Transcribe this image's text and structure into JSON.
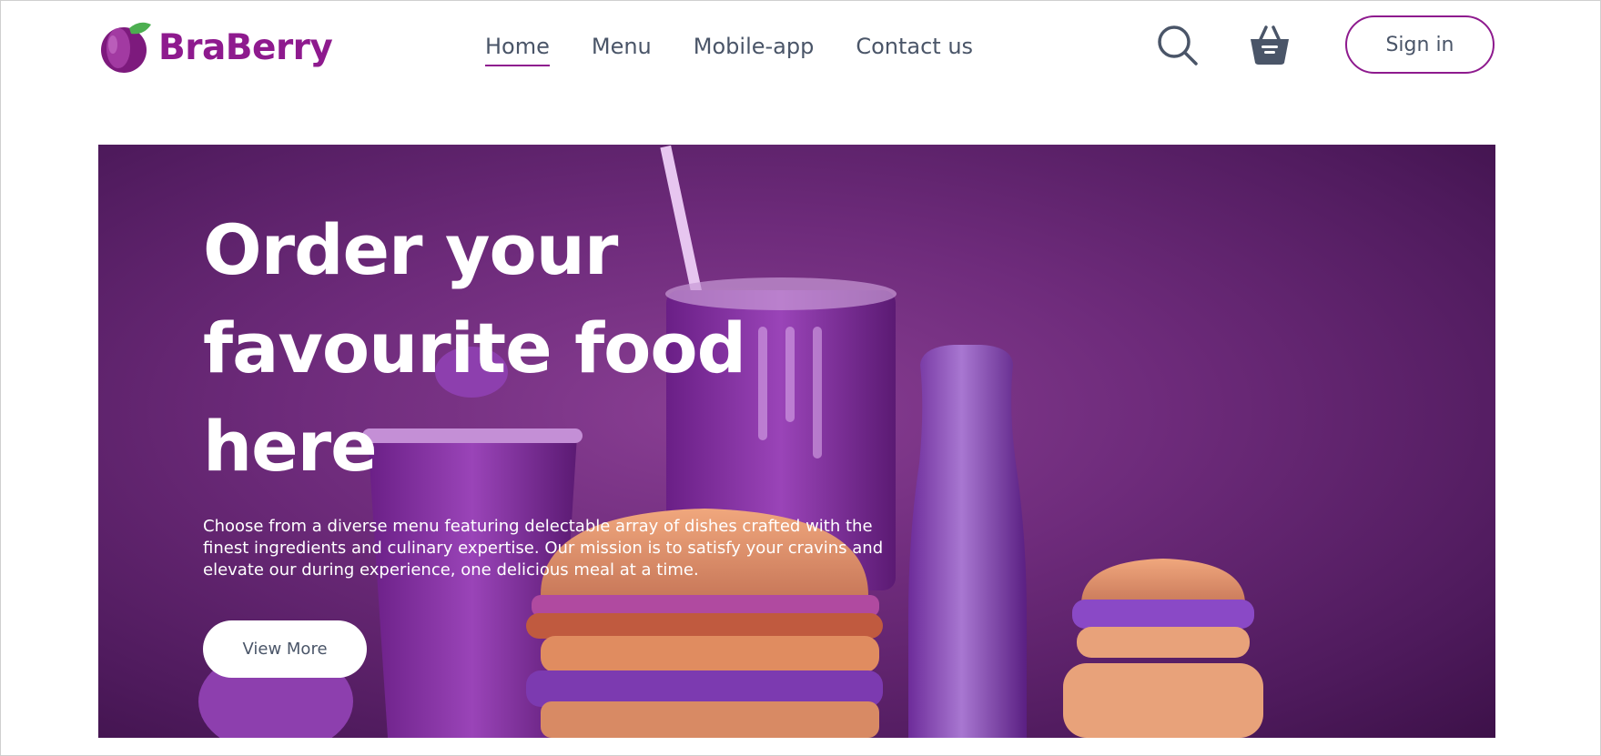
{
  "brand": {
    "name": "BraBerry",
    "color": "#8e1a8e"
  },
  "nav": {
    "items": [
      {
        "label": "Home",
        "active": true
      },
      {
        "label": "Menu",
        "active": false
      },
      {
        "label": "Mobile-app",
        "active": false
      },
      {
        "label": "Contact us",
        "active": false
      }
    ]
  },
  "header": {
    "search_icon": "search-icon",
    "basket_icon": "basket-icon",
    "signin_label": "Sign in"
  },
  "hero": {
    "title": "Order your favourite food here",
    "description": "Choose from a diverse menu featuring delectable array of dishes crafted with the finest ingredients and culinary expertise. Our mission is to satisfy your cravins and elevate our during experience, one delicious meal at a time.",
    "cta_label": "View More",
    "background_color": "#6e2b7b"
  },
  "colors": {
    "accent": "#8e1a8e",
    "nav_text": "#4a5568",
    "hero_text": "#ffffff"
  }
}
